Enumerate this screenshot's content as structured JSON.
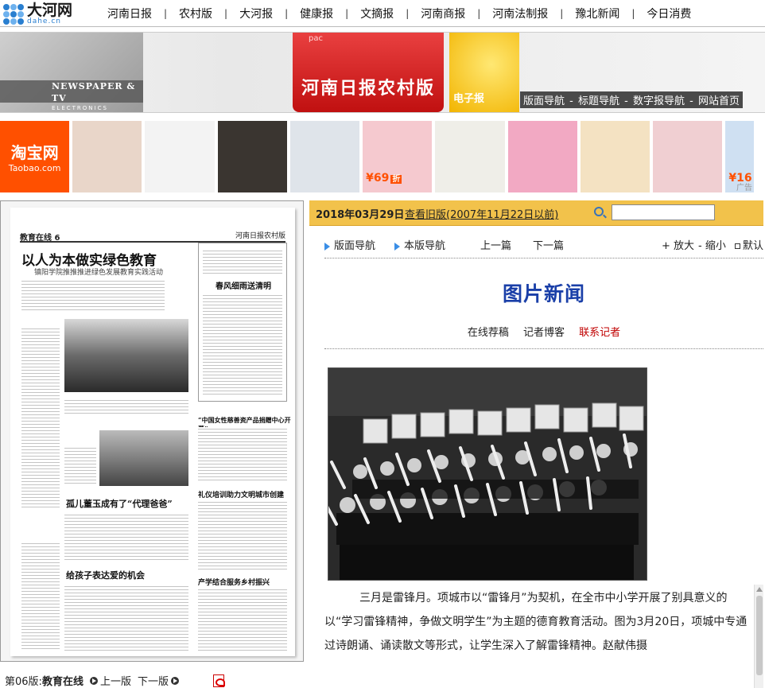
{
  "site": {
    "logo_cn": "大河网",
    "logo_en": "dahe.cn"
  },
  "topnav": [
    "河南日报",
    "农村版",
    "大河报",
    "健康报",
    "文摘报",
    "河南商报",
    "河南法制报",
    "豫北新闻",
    "今日消费"
  ],
  "banner": {
    "brand": "pac",
    "left_title": "NEWSPAPER & TV",
    "left_sub": "ELECTRONICS VERSION",
    "title": "河南日报农村版",
    "dzb": "电子报",
    "links": [
      "版面导航",
      "标题导航",
      "数字报导航",
      "网站首页"
    ],
    "link_sep": " - "
  },
  "taobao": {
    "logo_cn": "淘宝网",
    "logo_en": "Taobao.com",
    "items": [
      {
        "price": "",
        "color": "#e9d6c9"
      },
      {
        "price": "",
        "color": "#f3f3f3"
      },
      {
        "price": "",
        "color": "#3a3530"
      },
      {
        "price": "",
        "color": "#dfe4ea"
      },
      {
        "price": "¥69",
        "zhe": "折",
        "color": "#f5c9cf"
      },
      {
        "price": "",
        "color": "#efeee8"
      },
      {
        "price": "",
        "color": "#f2a9c3"
      },
      {
        "price": "",
        "color": "#f4e2c2"
      },
      {
        "price": "",
        "color": "#f0cfd2"
      },
      {
        "price": "¥16",
        "zhe": "",
        "color": "#cfe0f2",
        "ad": "广告"
      }
    ]
  },
  "paper": {
    "edition": "教育在线 6",
    "masthead": "河南日报农村版",
    "headline": "以人为本做实绿色教育",
    "subhead": "镇阳学院推推推进绿色发展教育实践活动",
    "h_spring": "春风细雨送清明",
    "h_dad": "孤儿董玉成有了“代理爸爸”",
    "h_child": "给孩子表达爱的机会",
    "h_civic": "礼仪培训助力文明城市创建",
    "h_fund": "“中国女性慈善资产品捐赠中心开幕”",
    "h_ind": "产学结合服务乡村振兴"
  },
  "left_footer": {
    "page_label": "第06版:",
    "page_name": "教育在线",
    "prev": "上一版",
    "next": "下一版"
  },
  "datebar": {
    "date": "2018年03月29日",
    "old_link": "查看旧版(2007年11月22日以前)",
    "search_value": ""
  },
  "navrow": {
    "nav1": "版面导航",
    "nav2": "本版导航",
    "prev": "上一篇",
    "next": "下一篇",
    "zoom_in": "+ 放大",
    "zoom_out": "- 缩小",
    "default": "默认"
  },
  "section_title": "图片新闻",
  "sublinks": [
    "在线荐稿",
    "记者博客",
    "联系记者"
  ],
  "article": "三月是雷锋月。项城市以“雷锋月”为契机，在全市中小学开展了别具意义的以“学习雷锋精神，争做文明学生”为主题的德育教育活动。图为3月20日，项城中专通过诗朗诵、诵读散文等形式，让学生深入了解雷锋精神。赵献伟摄",
  "colors": {
    "accent_blue": "#1a3fa8",
    "datebar": "#f2c24b",
    "taobao": "#ff5000",
    "red_link": "#c00000"
  }
}
